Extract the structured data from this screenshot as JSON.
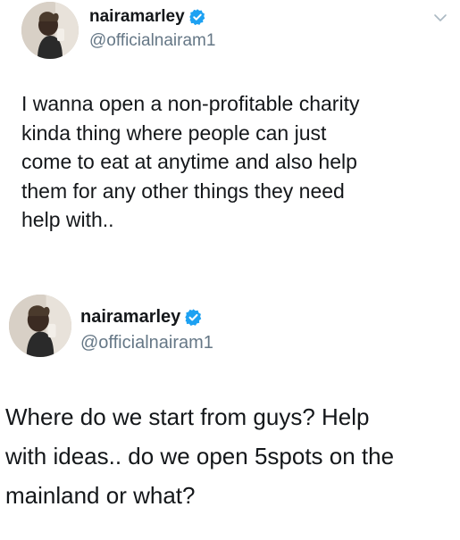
{
  "tweets": [
    {
      "display_name": "nairamarley",
      "handle": "@officialnairam1",
      "verified": true,
      "has_menu_chevron": true,
      "text_lines": [
        "I wanna open a non-profitable charity",
        "kinda thing where people can just",
        "come to eat at anytime and also help",
        "them for any other things they need",
        "help with.."
      ]
    },
    {
      "display_name": "nairamarley",
      "handle": "@officialnairam1",
      "verified": true,
      "has_menu_chevron": false,
      "text_lines": [
        "Where do we start from guys? Help",
        "with ideas.. do we open 5spots on the",
        "mainland or what?"
      ]
    }
  ],
  "icons": {
    "verified": "verified-badge-icon",
    "menu": "chevron-down-icon"
  },
  "colors": {
    "name": "#14171a",
    "handle": "#657786",
    "verified": "#1da1f2",
    "chevron": "#aab8c2"
  }
}
